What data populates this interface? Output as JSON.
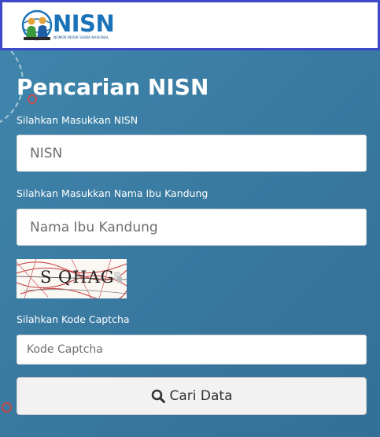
{
  "header": {
    "logo_text": "NISN",
    "logo_subtitle": "NOMOR INDUK SISWA NASIONAL"
  },
  "form": {
    "title": "Pencarian NISN",
    "nisn_label": "Silahkan Masukkan NISN",
    "nisn_placeholder": "NISN",
    "mother_label": "Silahkan Masukkan Nama Ibu Kandung",
    "mother_placeholder": "Nama Ibu Kandung",
    "captcha_image_text": "S QHAG",
    "captcha_label": "Silahkan Kode Captcha",
    "captcha_placeholder": "Kode Captcha",
    "submit_label": "Cari Data",
    "submit_icon": "search-icon"
  },
  "colors": {
    "header_border": "#3d49c9",
    "background": "#3f7ea3",
    "logo_blue": "#1a73b8"
  }
}
